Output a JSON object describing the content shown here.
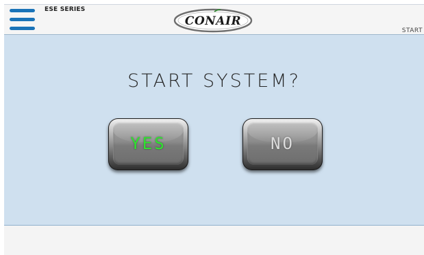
{
  "header": {
    "series_label": "ESE SERIES",
    "logo_text": "CONAIR",
    "status_text": "START",
    "menu_icon": "hamburger-menu-icon"
  },
  "dialog": {
    "prompt": "START SYSTEM?",
    "yes_label": "YES",
    "no_label": "NO"
  },
  "colors": {
    "menu_blue": "#1a73b8",
    "background": "#cfe0ef",
    "yes_text": "#2fe32f",
    "no_text": "#dcdcdc"
  }
}
